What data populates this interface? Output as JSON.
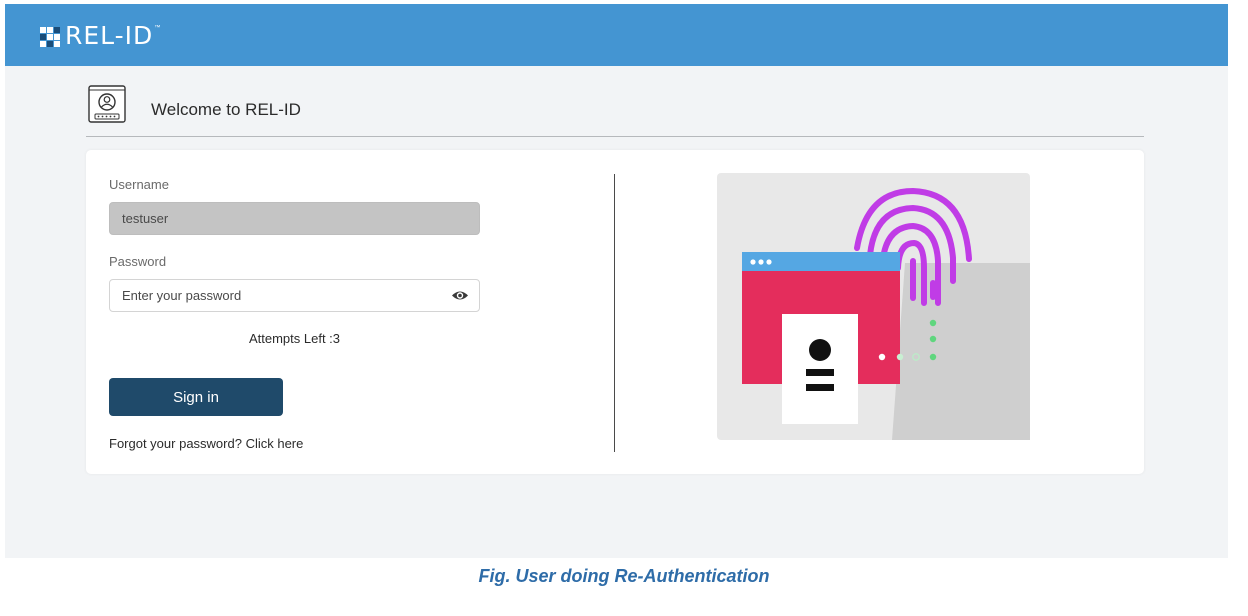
{
  "app": {
    "logo_text": "REL-ID",
    "trademark": "™"
  },
  "header": {
    "welcome_title": "Welcome to REL-ID"
  },
  "form": {
    "username_label": "Username",
    "username_value": "testuser",
    "password_label": "Password",
    "password_placeholder": "Enter your password",
    "attempts_text": "Attempts Left :3",
    "signin_label": "Sign in",
    "forgot_text": "Forgot your password? Click here"
  },
  "icons": [
    "user-badge-icon",
    "eye-icon",
    "fingerprint-icon"
  ],
  "colors": {
    "topbar": "#4495d2",
    "signin": "#1f4a6a",
    "caption": "#2e6ca8",
    "fingerprint": "#c03ce6",
    "window_red": "#e42d5c",
    "window_titlebar": "#55a7e3",
    "dots": "#5fd67e"
  },
  "caption": "Fig. User doing Re-Authentication"
}
